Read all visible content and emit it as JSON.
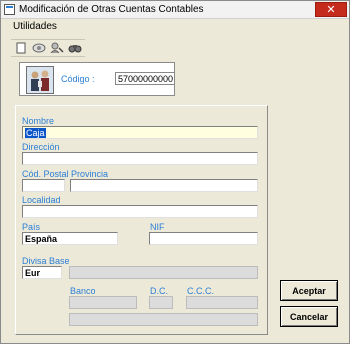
{
  "window": {
    "title": "Modificación de Otras Cuentas Contables",
    "close_glyph": "✕"
  },
  "menu": {
    "utilidades": "Utilidades"
  },
  "toolbar": {
    "icons": [
      "new-document-icon",
      "view-icon",
      "search-person-icon",
      "binoculars-icon"
    ]
  },
  "header": {
    "codigo_label": "Código :",
    "codigo_value": "57000000000"
  },
  "form": {
    "nombre_label": "Nombre",
    "nombre_value": "Caja",
    "direccion_label": "Dirección",
    "direccion_value": "",
    "cod_postal_label": "Cód. Postal",
    "cod_postal_value": "",
    "provincia_label": "Provincia",
    "provincia_value": "",
    "localidad_label": "Localidad",
    "localidad_value": "",
    "pais_label": "País",
    "pais_value": "España",
    "nif_label": "NIF",
    "nif_value": "",
    "divisa_label": "Divisa Base",
    "divisa_value": "Eur",
    "divisa_desc_value": "",
    "banco_label": "Banco",
    "dc_label": "D.C.",
    "ccc_label": "C.C.C."
  },
  "buttons": {
    "aceptar": "Aceptar",
    "cancelar": "Cancelar"
  }
}
